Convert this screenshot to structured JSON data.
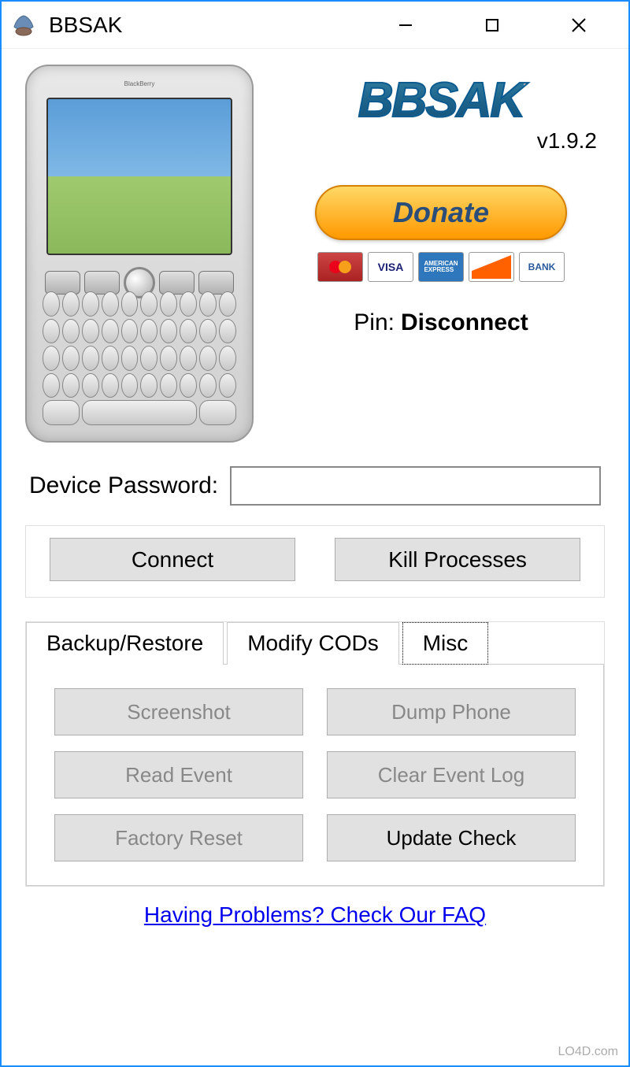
{
  "window": {
    "title": "BBSAK"
  },
  "logo": {
    "text": "BBSAK",
    "version": "v1.9.2"
  },
  "donate": {
    "label": "Donate"
  },
  "payment": {
    "cards": [
      "MasterCard",
      "VISA",
      "AMEX",
      "DISCOVER",
      "BANK"
    ]
  },
  "pin": {
    "label": "Pin:",
    "value": "Disconnect"
  },
  "password": {
    "label": "Device Password:",
    "value": ""
  },
  "buttons": {
    "connect": "Connect",
    "kill": "Kill Processes"
  },
  "tabs": {
    "items": [
      "Backup/Restore",
      "Modify CODs",
      "Misc"
    ],
    "active": 2
  },
  "misc_buttons": {
    "screenshot": "Screenshot",
    "dump_phone": "Dump Phone",
    "read_event": "Read Event",
    "clear_event": "Clear Event Log",
    "factory_reset": "Factory Reset",
    "update_check": "Update Check"
  },
  "faq": {
    "text": "Having Problems? Check Our FAQ"
  },
  "phone": {
    "brand": "BlackBerry"
  },
  "watermark": "LO4D.com"
}
